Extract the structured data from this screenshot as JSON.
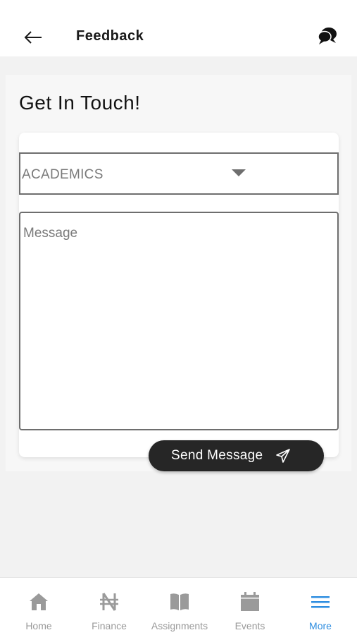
{
  "header": {
    "title": "Feedback",
    "back_icon": "arrow-left-icon",
    "chat_icon": "chat-bubbles-icon"
  },
  "main": {
    "title": "Get In Touch!",
    "category_select": {
      "selected": "ACADEMICS",
      "caret_icon": "caret-down-icon"
    },
    "message": {
      "placeholder": "Message",
      "value": ""
    },
    "send_button": {
      "label": "Send Message",
      "icon": "paper-plane-icon"
    }
  },
  "bottom_nav": {
    "items": [
      {
        "label": "Home",
        "icon": "home-icon",
        "active": false
      },
      {
        "label": "Finance",
        "icon": "naira-icon",
        "active": false
      },
      {
        "label": "Assignments",
        "icon": "book-icon",
        "active": false
      },
      {
        "label": "Events",
        "icon": "calendar-icon",
        "active": false
      },
      {
        "label": "More",
        "icon": "menu-icon",
        "active": true
      }
    ]
  },
  "colors": {
    "active": "#2f8ee0",
    "inactive": "#9a9a9a",
    "button_bg": "#262626",
    "page_bg": "#f2f2f2"
  }
}
